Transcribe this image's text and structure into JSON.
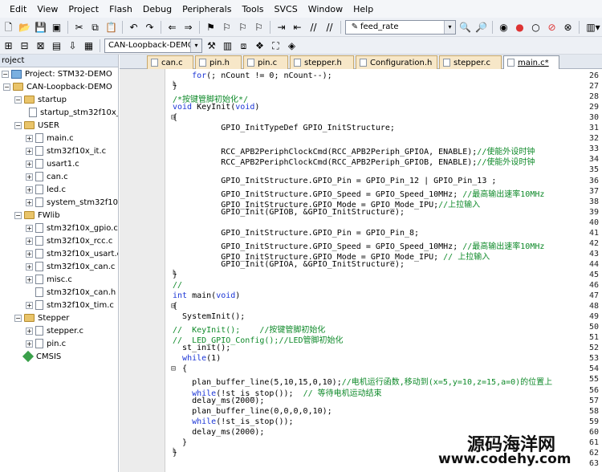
{
  "menu": [
    "Edit",
    "View",
    "Project",
    "Flash",
    "Debug",
    "Peripherals",
    "Tools",
    "SVCS",
    "Window",
    "Help"
  ],
  "toolbar": {
    "find_value": "feed_rate",
    "target_value": "CAN-Loopback-DEMO"
  },
  "sidebar": {
    "header": "roject",
    "project_label": "Project: STM32-DEMO",
    "target_label": "CAN-Loopback-DEMO",
    "groups": {
      "startup": {
        "label": "startup",
        "files": [
          "startup_stm32f10x_"
        ]
      },
      "user": {
        "label": "USER",
        "files": [
          "main.c",
          "stm32f10x_it.c",
          "usart1.c",
          "can.c",
          "led.c",
          "system_stm32f10x"
        ]
      },
      "fwlib": {
        "label": "FWlib",
        "files": [
          "stm32f10x_gpio.c",
          "stm32f10x_rcc.c",
          "stm32f10x_usart.c",
          "stm32f10x_can.c",
          "misc.c",
          "stm32f10x_can.h",
          "stm32f10x_tim.c"
        ]
      },
      "stepper": {
        "label": "Stepper",
        "files": [
          "stepper.c",
          "pin.c"
        ]
      },
      "cmsis": {
        "label": "CMSIS"
      }
    }
  },
  "tabs": [
    "can.c",
    "pin.h",
    "pin.c",
    "stepper.h",
    "Configuration.h",
    "stepper.c",
    "main.c*"
  ],
  "code": [
    {
      "n": "26",
      "fold": "",
      "t": "    for(; nCount != 0; nCount--);",
      "c": ""
    },
    {
      "n": "27",
      "fold": "└",
      "t": "}",
      "c": ""
    },
    {
      "n": "28",
      "fold": "",
      "t": "",
      "c": "/*按键管脚初始化*/"
    },
    {
      "n": "29",
      "fold": "",
      "t": "void KeyInit(void)",
      "c": ""
    },
    {
      "n": "30",
      "fold": "⊟",
      "t": "{",
      "c": ""
    },
    {
      "n": "31",
      "fold": "",
      "t": "          GPIO_InitTypeDef GPIO_InitStructure;",
      "c": ""
    },
    {
      "n": "32",
      "fold": "",
      "t": "",
      "c": ""
    },
    {
      "n": "33",
      "fold": "",
      "t": "          RCC_APB2PeriphClockCmd(RCC_APB2Periph_GPIOA, ENABLE);",
      "c": "//使能外设时钟"
    },
    {
      "n": "34",
      "fold": "",
      "t": "          RCC_APB2PeriphClockCmd(RCC_APB2Periph_GPIOB, ENABLE);",
      "c": "//使能外设时钟"
    },
    {
      "n": "35",
      "fold": "",
      "t": "",
      "c": ""
    },
    {
      "n": "36",
      "fold": "",
      "t": "          GPIO_InitStructure.GPIO_Pin = GPIO_Pin_12 | GPIO_Pin_13 ;",
      "c": ""
    },
    {
      "n": "37",
      "fold": "",
      "t": "          GPIO_InitStructure.GPIO_Speed = GPIO_Speed_10MHz; ",
      "c": "//最高输出速率10MHz"
    },
    {
      "n": "38",
      "fold": "",
      "t": "          GPIO_InitStructure.GPIO_Mode = GPIO_Mode_IPU;",
      "c": "//上拉输入"
    },
    {
      "n": "39",
      "fold": "",
      "t": "          GPIO_Init(GPIOB, &GPIO_InitStructure);",
      "c": ""
    },
    {
      "n": "40",
      "fold": "",
      "t": "",
      "c": ""
    },
    {
      "n": "41",
      "fold": "",
      "t": "          GPIO_InitStructure.GPIO_Pin = GPIO_Pin_8;",
      "c": ""
    },
    {
      "n": "42",
      "fold": "",
      "t": "          GPIO_InitStructure.GPIO_Speed = GPIO_Speed_10MHz; ",
      "c": "//最高输出速率10MHz"
    },
    {
      "n": "43",
      "fold": "",
      "t": "          GPIO_InitStructure.GPIO_Mode = GPIO_Mode_IPU; ",
      "c": "// 上拉输入"
    },
    {
      "n": "44",
      "fold": "",
      "t": "          GPIO_Init(GPIOA, &GPIO_InitStructure);",
      "c": ""
    },
    {
      "n": "45",
      "fold": "└",
      "t": "}",
      "c": ""
    },
    {
      "n": "46",
      "fold": "",
      "t": "",
      "c": "//"
    },
    {
      "n": "47",
      "fold": "",
      "t": "int main(void)",
      "c": ""
    },
    {
      "n": "48",
      "fold": "⊟",
      "t": "{",
      "c": ""
    },
    {
      "n": "49",
      "fold": "",
      "t": "  SystemInit();",
      "c": ""
    },
    {
      "n": "50",
      "fold": "",
      "t": "",
      "c": "//  KeyInit();    //按键管脚初始化"
    },
    {
      "n": "51",
      "fold": "",
      "t": "",
      "c": "//  LED_GPIO_Config();//LED管脚初始化"
    },
    {
      "n": "52",
      "fold": "",
      "t": "  st_init();",
      "c": ""
    },
    {
      "n": "53",
      "fold": "",
      "t": "  while(1)",
      "c": ""
    },
    {
      "n": "54",
      "fold": "⊟",
      "t": "  {",
      "c": ""
    },
    {
      "n": "55",
      "fold": "",
      "t": "    plan_buffer_line(5,10,15,0,10);",
      "c": "//电机运行函数,移动到(x=5,y=10,z=15,a=0)的位置上"
    },
    {
      "n": "56",
      "fold": "",
      "t": "    while(!st_is_stop());  ",
      "c": "// 等待电机运动结束"
    },
    {
      "n": "57",
      "fold": "",
      "t": "    delay_ms(2000);",
      "c": ""
    },
    {
      "n": "58",
      "fold": "",
      "t": "    plan_buffer_line(0,0,0,0,10);",
      "c": ""
    },
    {
      "n": "59",
      "fold": "",
      "t": "    while(!st_is_stop());",
      "c": ""
    },
    {
      "n": "60",
      "fold": "",
      "t": "    delay_ms(2000);",
      "c": ""
    },
    {
      "n": "61",
      "fold": "",
      "t": "  }",
      "c": ""
    },
    {
      "n": "62",
      "fold": "└",
      "t": "}",
      "c": ""
    },
    {
      "n": "63",
      "fold": "",
      "t": "",
      "c": ""
    }
  ],
  "watermark": {
    "line1": "源码海洋网",
    "line2": "www.codehy.com"
  },
  "colors": {
    "comment": "#0f8a2a",
    "keyword": "#1b35d6",
    "tab_bg": "#f7e7c8"
  }
}
